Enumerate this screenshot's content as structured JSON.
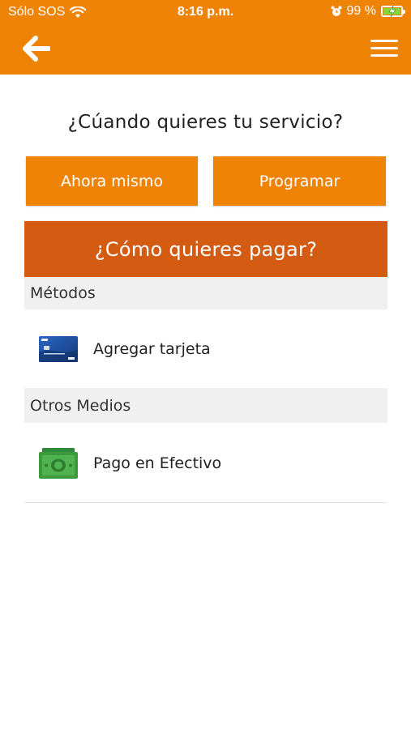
{
  "status_bar": {
    "carrier": "Sólo SOS",
    "time": "8:16 p.m.",
    "battery": "99 %"
  },
  "nav": {
    "back_icon": "arrow-left-icon",
    "menu_icon": "hamburger-menu-icon"
  },
  "schedule": {
    "question": "¿Cúando quieres tu servicio?",
    "now_label": "Ahora mismo",
    "schedule_label": "Programar"
  },
  "payment": {
    "header": "¿Cómo quieres pagar?",
    "methods_section": "Métodos",
    "add_card_label": "Agregar tarjeta",
    "other_section": "Otros Medios",
    "cash_label": "Pago en Efectivo"
  },
  "colors": {
    "primary_orange": "#ee8306",
    "dark_orange": "#d35b12",
    "section_gray": "#f0f0f0",
    "card_blue": "#1f4e9a",
    "cash_green": "#3c9a3c"
  }
}
